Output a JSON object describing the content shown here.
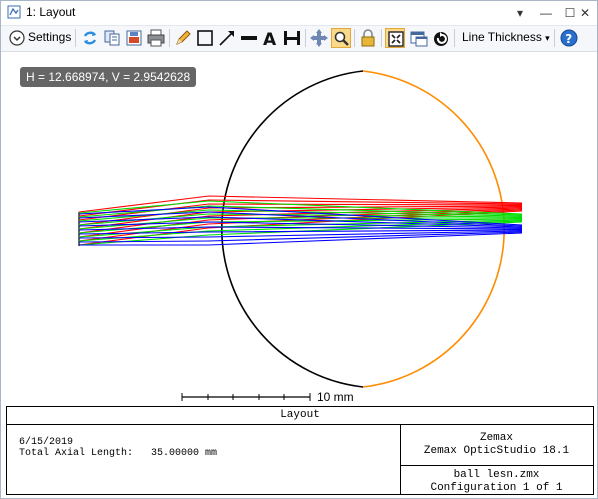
{
  "window": {
    "title": "1: Layout"
  },
  "titlebar": {
    "menu_glyph": "▾",
    "minimize_glyph": "—",
    "maximize_glyph": "☐",
    "close_glyph": "✕"
  },
  "toolbar": {
    "settings_label": "Settings",
    "line_thickness_label": "Line Thickness",
    "line_thickness_arrow": "▾",
    "icons": [
      "settings-chevron-icon",
      "refresh-icon",
      "copy-icon",
      "export-icon",
      "print-icon",
      "pencil-icon",
      "rectangle-icon",
      "arrow-icon",
      "line-icon",
      "text-icon",
      "dimension-icon",
      "pan-icon",
      "zoom-icon",
      "lock-icon",
      "fit-icon",
      "window-icon",
      "rotate-icon",
      "help-icon"
    ]
  },
  "plot": {
    "coord_readout": "H = 12.668974, V = 2.9542628",
    "scale_label": "10 mm",
    "ray_colors": {
      "red": "#ff0000",
      "green": "#00dd00",
      "blue": "#0000ff"
    },
    "lens_colors": {
      "front": "#000000",
      "back": "#ff8c00"
    }
  },
  "footer": {
    "title": "Layout",
    "date": "6/15/2019",
    "axial_length": "Total Axial Length:   35.00000 mm",
    "brand_line1": "Zemax",
    "brand_line2": "Zemax OpticStudio 18.1",
    "file_name": "ball lesn.zmx",
    "configuration": "Configuration 1 of 1"
  }
}
